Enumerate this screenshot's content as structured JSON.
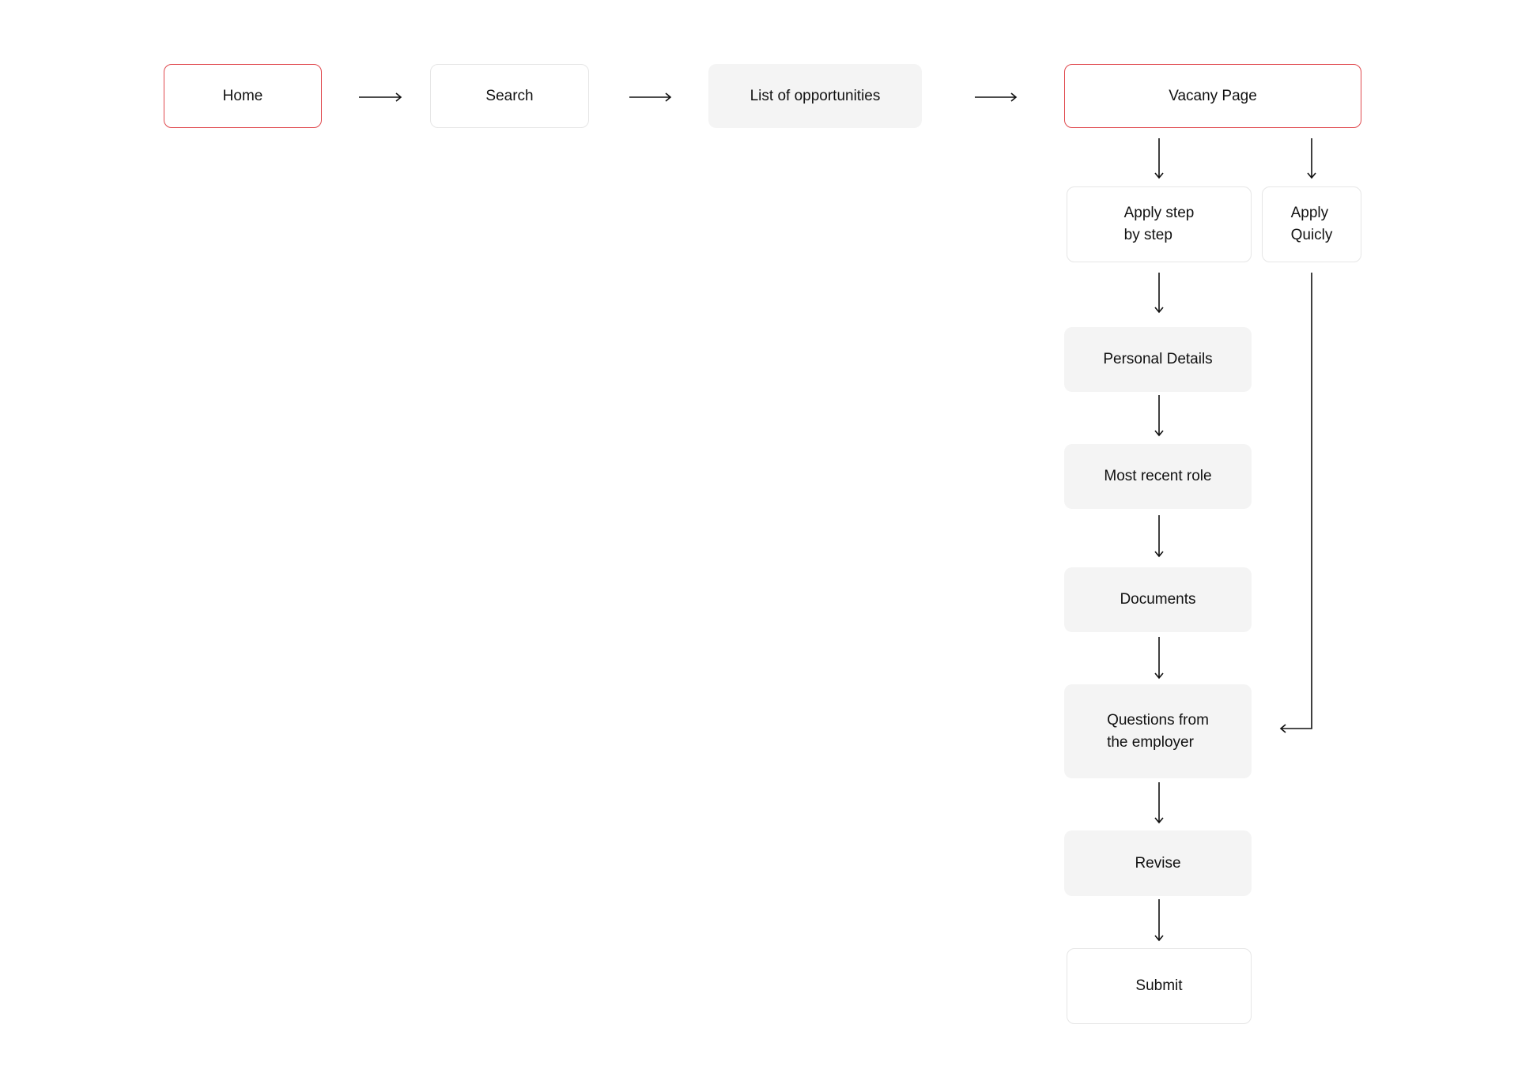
{
  "nodes": {
    "home": "Home",
    "search": "Search",
    "list": "List of opportunities",
    "vacancy": "Vacany Page",
    "apply_step": "Apply step\nby step",
    "apply_quick": "Apply\nQuicly",
    "personal": "Personal Details",
    "recent_role": "Most recent role",
    "documents": "Documents",
    "questions": "Questions from\nthe employer",
    "revise": "Revise",
    "submit": "Submit"
  },
  "colors": {
    "highlight_border": "#e0484d",
    "fill": "#f4f4f4",
    "border": "#e6e6e6"
  }
}
